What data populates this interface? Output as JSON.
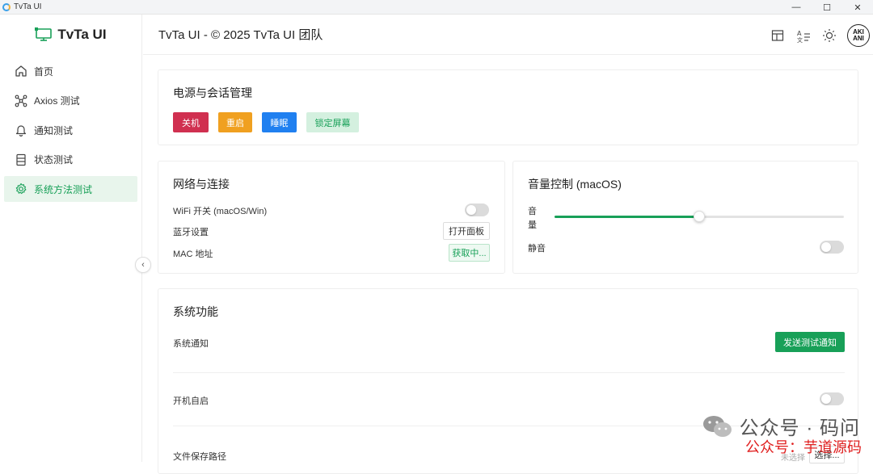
{
  "window": {
    "title": "TvTa UI",
    "minimize": "—",
    "maximize": "☐",
    "close": "✕"
  },
  "sidebar": {
    "brand": "TvTa UI",
    "items": [
      {
        "label": "首页",
        "icon": "home-icon"
      },
      {
        "label": "Axios 测试",
        "icon": "network-icon"
      },
      {
        "label": "通知测试",
        "icon": "bell-icon"
      },
      {
        "label": "状态测试",
        "icon": "server-icon"
      },
      {
        "label": "系统方法测试",
        "icon": "gear-icon",
        "active": true
      }
    ],
    "collapse": "‹"
  },
  "header": {
    "title": "TvTa UI - © 2025 TvTa UI 团队",
    "avatar_text": "AKI ANI"
  },
  "power": {
    "title": "电源与会话管理",
    "buttons": [
      "关机",
      "重启",
      "睡眠",
      "锁定屏幕"
    ]
  },
  "network": {
    "title": "网络与连接",
    "wifi_label": "WiFi 开关 (macOS/Win)",
    "wifi_on": false,
    "bluetooth_label": "蓝牙设置",
    "bluetooth_button": "打开面板",
    "mac_label": "MAC 地址",
    "mac_button": "获取中..."
  },
  "volume": {
    "title": "音量控制 (macOS)",
    "volume_label_1": "音",
    "volume_label_2": "量",
    "level": 0.5,
    "mute_label": "静音",
    "mute_on": false
  },
  "system": {
    "title": "系统功能",
    "notify_label": "系统通知",
    "notify_button": "发送测试通知",
    "autostart_label": "开机自启",
    "autostart_on": false,
    "path_label": "文件保存路径",
    "path_value": "未选择",
    "path_button": "选择..."
  },
  "watermark": {
    "line1": "公众号 · 码问",
    "line2": "公众号：芋道源码"
  },
  "colors": {
    "accent": "#18a058",
    "danger": "#d03050",
    "warning": "#f0a020",
    "info": "#2080f0"
  }
}
